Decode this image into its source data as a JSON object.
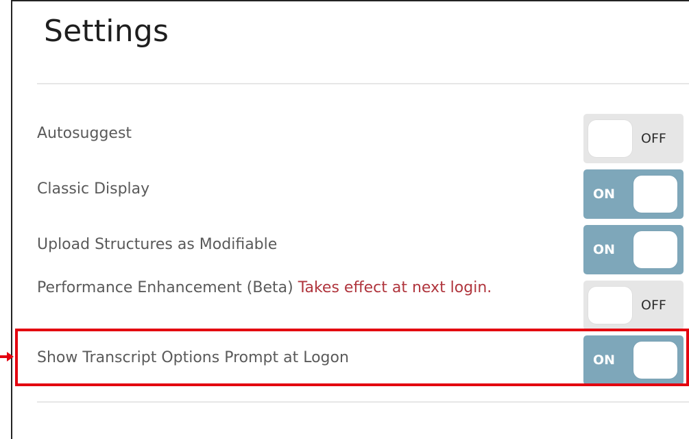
{
  "page": {
    "title": "Settings"
  },
  "settings": [
    {
      "label": "Autosuggest",
      "note": "",
      "state": "OFF"
    },
    {
      "label": "Classic Display",
      "note": "",
      "state": "ON"
    },
    {
      "label": "Upload Structures as Modifiable",
      "note": "",
      "state": "ON"
    },
    {
      "label": "Performance Enhancement (Beta)",
      "note": "Takes effect at next login.",
      "state": "OFF"
    },
    {
      "label": "Show Transcript Options Prompt at Logon",
      "note": "",
      "state": "ON"
    }
  ],
  "annotation": {
    "highlight_color": "#e3000f",
    "highlighted_setting_index": 4
  },
  "colors": {
    "toggle_on": "#7ea7ba",
    "toggle_off": "#e6e6e6",
    "note_text": "#b0353d"
  }
}
